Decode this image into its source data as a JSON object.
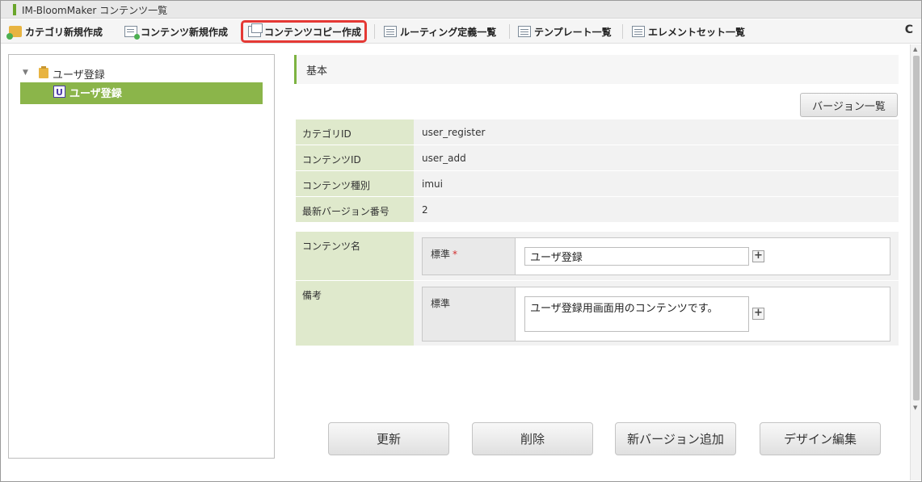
{
  "window": {
    "title": "IM-BloomMaker コンテンツ一覧"
  },
  "toolbar": {
    "items": [
      {
        "label": "カテゴリ新規作成",
        "icon": "folder-add-icon"
      },
      {
        "label": "コンテンツ新規作成",
        "icon": "document-add-icon"
      },
      {
        "label": "コンテンツコピー作成",
        "icon": "copy-icon",
        "highlighted": true
      },
      {
        "label": "ルーティング定義一覧",
        "icon": "list-icon"
      },
      {
        "label": "テンプレート一覧",
        "icon": "list-icon"
      },
      {
        "label": "エレメントセット一覧",
        "icon": "list-icon"
      }
    ],
    "refresh_icon": "C"
  },
  "tree": {
    "root_label": "ユーザ登録",
    "toggle_glyph": "▼",
    "selected_icon_letter": "U",
    "selected_label": "ユーザ登録"
  },
  "section": {
    "title": "基本"
  },
  "version_button": "バージョン一覧",
  "info_rows": [
    {
      "label": "カテゴリID",
      "value": "user_register"
    },
    {
      "label": "コンテンツID",
      "value": "user_add"
    },
    {
      "label": "コンテンツ種別",
      "value": "imui"
    },
    {
      "label": "最新バージョン番号",
      "value": "2"
    }
  ],
  "content_name": {
    "label": "コンテンツ名",
    "locale_label": "標準",
    "required_mark": "*",
    "value": "ユーザ登録"
  },
  "remarks": {
    "label": "備考",
    "locale_label": "標準",
    "value": "ユーザ登録用画面用のコンテンツです。"
  },
  "plus_glyph": "+",
  "actions": {
    "update": "更新",
    "delete": "削除",
    "new_version": "新バージョン追加",
    "design_edit": "デザイン編集"
  },
  "colors": {
    "accent_green": "#8bb54a",
    "label_bg": "#dfe9cc",
    "highlight_red": "#e53935"
  }
}
